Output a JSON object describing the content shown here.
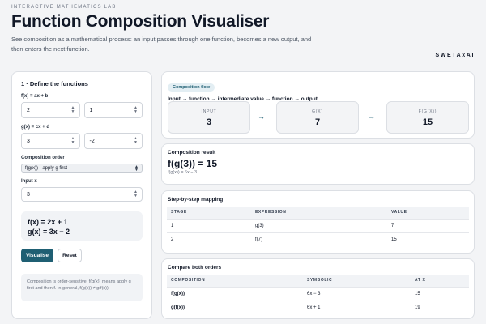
{
  "header": {
    "kicker": "INTERACTIVE MATHEMATICS LAB",
    "title": "Function Composition Visualiser",
    "subtitle": "See composition as a mathematical process: an input passes through one function, becomes a new output, and then enters the next function.",
    "brand": "SWETAxAI"
  },
  "define": {
    "title": "1 · Define the functions",
    "f_label": "f(x) = ax + b",
    "f_a": "2",
    "f_b": "1",
    "g_label": "g(x) = cx + d",
    "g_c": "3",
    "g_d": "-2",
    "order_label": "Composition order",
    "order_value": "f(g(x)) - apply g first",
    "input_label": "Input x",
    "input_value": "3",
    "formula_f": "f(x) = 2x + 1",
    "formula_g": "g(x) = 3x − 2",
    "visualise_label": "Visualise",
    "reset_label": "Reset",
    "note": "Composition is order-sensitive: f(g(x)) means apply g first and then f. In general, f(g(x)) ≠ g(f(x))."
  },
  "flow": {
    "pill": "Composition flow",
    "path": "Input → function → intermediate value → function → output",
    "boxes": [
      {
        "label": "INPUT",
        "value": "3"
      },
      {
        "label": "G(X)",
        "value": "7"
      },
      {
        "label": "F(G(X))",
        "value": "15"
      }
    ],
    "arrow": "→"
  },
  "result": {
    "label": "Composition result",
    "value": "f(g(3)) = 15",
    "expression": "f(g(x)) = 6x − 3"
  },
  "steps": {
    "title": "Step-by-step mapping",
    "headers": [
      "STAGE",
      "EXPRESSION",
      "VALUE"
    ],
    "rows": [
      [
        "1",
        "g(3)",
        "7"
      ],
      [
        "2",
        "f(7)",
        "15"
      ]
    ]
  },
  "compare": {
    "title": "Compare both orders",
    "headers": [
      "COMPOSITION",
      "SYMBOLIC",
      "AT X"
    ],
    "rows": [
      [
        "f(g(x))",
        "6x − 3",
        "15"
      ],
      [
        "g(f(x))",
        "6x + 1",
        "19"
      ]
    ]
  }
}
